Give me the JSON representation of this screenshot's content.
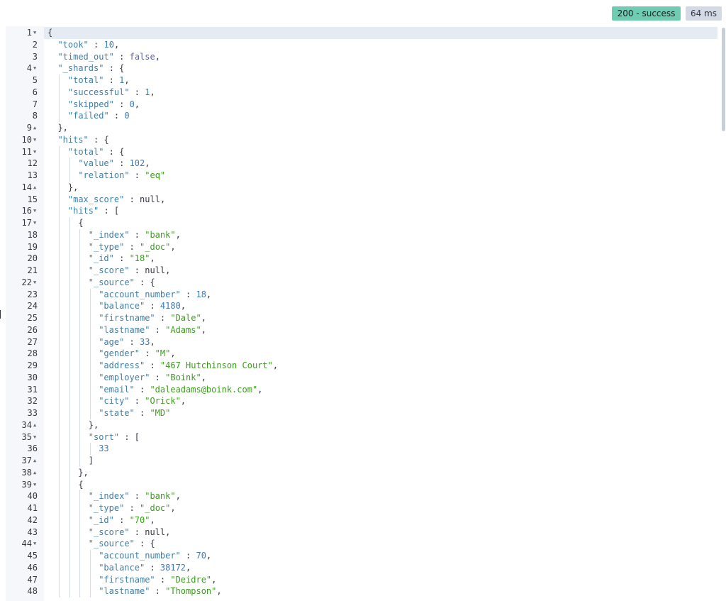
{
  "status": {
    "code_label": "200 - success",
    "time_label": "64 ms"
  },
  "colors": {
    "success": "#6dccb1",
    "time_badge": "#d3dae6",
    "key": "#3f7ea6",
    "string": "#3c9c1e",
    "number": "#3d7bb5",
    "boolean": "#5f60b7",
    "gutter": "#f5f7fa",
    "active_line": "#e5ebf3"
  },
  "icons": {
    "fold_open": "chevron-down-icon",
    "fold_close": "chevron-up-icon"
  },
  "editor": {
    "lines": [
      {
        "n": "1",
        "f": "open",
        "d": 0,
        "t": [
          [
            "p",
            "{"
          ]
        ]
      },
      {
        "n": "2",
        "d": 1,
        "t": [
          [
            "k",
            "\"took\""
          ],
          [
            "p",
            " : "
          ],
          [
            "n",
            "10"
          ],
          [
            "p",
            ","
          ]
        ]
      },
      {
        "n": "3",
        "d": 1,
        "t": [
          [
            "k",
            "\"timed_out\""
          ],
          [
            "p",
            " : "
          ],
          [
            "b",
            "false"
          ],
          [
            "p",
            ","
          ]
        ]
      },
      {
        "n": "4",
        "f": "open",
        "d": 1,
        "t": [
          [
            "k",
            "\"_shards\""
          ],
          [
            "p",
            " : {"
          ]
        ]
      },
      {
        "n": "5",
        "d": 2,
        "t": [
          [
            "k",
            "\"total\""
          ],
          [
            "p",
            " : "
          ],
          [
            "n",
            "1"
          ],
          [
            "p",
            ","
          ]
        ]
      },
      {
        "n": "6",
        "d": 2,
        "t": [
          [
            "k",
            "\"successful\""
          ],
          [
            "p",
            " : "
          ],
          [
            "n",
            "1"
          ],
          [
            "p",
            ","
          ]
        ]
      },
      {
        "n": "7",
        "d": 2,
        "t": [
          [
            "k",
            "\"skipped\""
          ],
          [
            "p",
            " : "
          ],
          [
            "n",
            "0"
          ],
          [
            "p",
            ","
          ]
        ]
      },
      {
        "n": "8",
        "d": 2,
        "t": [
          [
            "k",
            "\"failed\""
          ],
          [
            "p",
            " : "
          ],
          [
            "n",
            "0"
          ]
        ]
      },
      {
        "n": "9",
        "f": "close",
        "d": 1,
        "t": [
          [
            "p",
            "},"
          ]
        ]
      },
      {
        "n": "10",
        "f": "open",
        "d": 1,
        "t": [
          [
            "k",
            "\"hits\""
          ],
          [
            "p",
            " : {"
          ]
        ]
      },
      {
        "n": "11",
        "f": "open",
        "d": 2,
        "t": [
          [
            "k",
            "\"total\""
          ],
          [
            "p",
            " : {"
          ]
        ]
      },
      {
        "n": "12",
        "d": 3,
        "t": [
          [
            "k",
            "\"value\""
          ],
          [
            "p",
            " : "
          ],
          [
            "n",
            "102"
          ],
          [
            "p",
            ","
          ]
        ]
      },
      {
        "n": "13",
        "d": 3,
        "t": [
          [
            "k",
            "\"relation\""
          ],
          [
            "p",
            " : "
          ],
          [
            "s",
            "\"eq\""
          ]
        ]
      },
      {
        "n": "14",
        "f": "close",
        "d": 2,
        "t": [
          [
            "p",
            "},"
          ]
        ]
      },
      {
        "n": "15",
        "d": 2,
        "t": [
          [
            "k",
            "\"max_score\""
          ],
          [
            "p",
            " : "
          ],
          [
            "nl",
            "null"
          ],
          [
            "p",
            ","
          ]
        ]
      },
      {
        "n": "16",
        "f": "open",
        "d": 2,
        "t": [
          [
            "k",
            "\"hits\""
          ],
          [
            "p",
            " : ["
          ]
        ]
      },
      {
        "n": "17",
        "f": "open",
        "d": 3,
        "t": [
          [
            "p",
            "{"
          ]
        ]
      },
      {
        "n": "18",
        "d": 4,
        "t": [
          [
            "k",
            "\"_index\""
          ],
          [
            "p",
            " : "
          ],
          [
            "s",
            "\"bank\""
          ],
          [
            "p",
            ","
          ]
        ]
      },
      {
        "n": "19",
        "d": 4,
        "t": [
          [
            "k",
            "\"_type\""
          ],
          [
            "p",
            " : "
          ],
          [
            "s",
            "\"_doc\""
          ],
          [
            "p",
            ","
          ]
        ]
      },
      {
        "n": "20",
        "d": 4,
        "t": [
          [
            "k",
            "\"_id\""
          ],
          [
            "p",
            " : "
          ],
          [
            "s",
            "\"18\""
          ],
          [
            "p",
            ","
          ]
        ]
      },
      {
        "n": "21",
        "d": 4,
        "t": [
          [
            "k",
            "\"_score\""
          ],
          [
            "p",
            " : "
          ],
          [
            "nl",
            "null"
          ],
          [
            "p",
            ","
          ]
        ]
      },
      {
        "n": "22",
        "f": "open",
        "d": 4,
        "t": [
          [
            "k",
            "\"_source\""
          ],
          [
            "p",
            " : {"
          ]
        ]
      },
      {
        "n": "23",
        "d": 5,
        "t": [
          [
            "k",
            "\"account_number\""
          ],
          [
            "p",
            " : "
          ],
          [
            "n",
            "18"
          ],
          [
            "p",
            ","
          ]
        ]
      },
      {
        "n": "24",
        "d": 5,
        "t": [
          [
            "k",
            "\"balance\""
          ],
          [
            "p",
            " : "
          ],
          [
            "n",
            "4180"
          ],
          [
            "p",
            ","
          ]
        ]
      },
      {
        "n": "25",
        "d": 5,
        "t": [
          [
            "k",
            "\"firstname\""
          ],
          [
            "p",
            " : "
          ],
          [
            "s",
            "\"Dale\""
          ],
          [
            "p",
            ","
          ]
        ]
      },
      {
        "n": "26",
        "d": 5,
        "t": [
          [
            "k",
            "\"lastname\""
          ],
          [
            "p",
            " : "
          ],
          [
            "s",
            "\"Adams\""
          ],
          [
            "p",
            ","
          ]
        ]
      },
      {
        "n": "27",
        "d": 5,
        "t": [
          [
            "k",
            "\"age\""
          ],
          [
            "p",
            " : "
          ],
          [
            "n",
            "33"
          ],
          [
            "p",
            ","
          ]
        ]
      },
      {
        "n": "28",
        "d": 5,
        "t": [
          [
            "k",
            "\"gender\""
          ],
          [
            "p",
            " : "
          ],
          [
            "s",
            "\"M\""
          ],
          [
            "p",
            ","
          ]
        ]
      },
      {
        "n": "29",
        "d": 5,
        "t": [
          [
            "k",
            "\"address\""
          ],
          [
            "p",
            " : "
          ],
          [
            "s",
            "\"467 Hutchinson Court\""
          ],
          [
            "p",
            ","
          ]
        ]
      },
      {
        "n": "30",
        "d": 5,
        "t": [
          [
            "k",
            "\"employer\""
          ],
          [
            "p",
            " : "
          ],
          [
            "s",
            "\"Boink\""
          ],
          [
            "p",
            ","
          ]
        ]
      },
      {
        "n": "31",
        "d": 5,
        "t": [
          [
            "k",
            "\"email\""
          ],
          [
            "p",
            " : "
          ],
          [
            "s",
            "\"daleadams@boink.com\""
          ],
          [
            "p",
            ","
          ]
        ]
      },
      {
        "n": "32",
        "d": 5,
        "t": [
          [
            "k",
            "\"city\""
          ],
          [
            "p",
            " : "
          ],
          [
            "s",
            "\"Orick\""
          ],
          [
            "p",
            ","
          ]
        ]
      },
      {
        "n": "33",
        "d": 5,
        "t": [
          [
            "k",
            "\"state\""
          ],
          [
            "p",
            " : "
          ],
          [
            "s",
            "\"MD\""
          ]
        ]
      },
      {
        "n": "34",
        "f": "close",
        "d": 4,
        "t": [
          [
            "p",
            "},"
          ]
        ]
      },
      {
        "n": "35",
        "f": "open",
        "d": 4,
        "t": [
          [
            "k",
            "\"sort\""
          ],
          [
            "p",
            " : ["
          ]
        ]
      },
      {
        "n": "36",
        "d": 5,
        "t": [
          [
            "n",
            "33"
          ]
        ]
      },
      {
        "n": "37",
        "f": "close",
        "d": 4,
        "t": [
          [
            "p",
            "]"
          ]
        ]
      },
      {
        "n": "38",
        "f": "close",
        "d": 3,
        "t": [
          [
            "p",
            "},"
          ]
        ]
      },
      {
        "n": "39",
        "f": "open",
        "d": 3,
        "t": [
          [
            "p",
            "{"
          ]
        ]
      },
      {
        "n": "40",
        "d": 4,
        "t": [
          [
            "k",
            "\"_index\""
          ],
          [
            "p",
            " : "
          ],
          [
            "s",
            "\"bank\""
          ],
          [
            "p",
            ","
          ]
        ]
      },
      {
        "n": "41",
        "d": 4,
        "t": [
          [
            "k",
            "\"_type\""
          ],
          [
            "p",
            " : "
          ],
          [
            "s",
            "\"_doc\""
          ],
          [
            "p",
            ","
          ]
        ]
      },
      {
        "n": "42",
        "d": 4,
        "t": [
          [
            "k",
            "\"_id\""
          ],
          [
            "p",
            " : "
          ],
          [
            "s",
            "\"70\""
          ],
          [
            "p",
            ","
          ]
        ]
      },
      {
        "n": "43",
        "d": 4,
        "t": [
          [
            "k",
            "\"_score\""
          ],
          [
            "p",
            " : "
          ],
          [
            "nl",
            "null"
          ],
          [
            "p",
            ","
          ]
        ]
      },
      {
        "n": "44",
        "f": "open",
        "d": 4,
        "t": [
          [
            "k",
            "\"_source\""
          ],
          [
            "p",
            " : {"
          ]
        ]
      },
      {
        "n": "45",
        "d": 5,
        "t": [
          [
            "k",
            "\"account_number\""
          ],
          [
            "p",
            " : "
          ],
          [
            "n",
            "70"
          ],
          [
            "p",
            ","
          ]
        ]
      },
      {
        "n": "46",
        "d": 5,
        "t": [
          [
            "k",
            "\"balance\""
          ],
          [
            "p",
            " : "
          ],
          [
            "n",
            "38172"
          ],
          [
            "p",
            ","
          ]
        ]
      },
      {
        "n": "47",
        "d": 5,
        "t": [
          [
            "k",
            "\"firstname\""
          ],
          [
            "p",
            " : "
          ],
          [
            "s",
            "\"Deidre\""
          ],
          [
            "p",
            ","
          ]
        ]
      },
      {
        "n": "48",
        "d": 5,
        "t": [
          [
            "k",
            "\"lastname\""
          ],
          [
            "p",
            " : "
          ],
          [
            "s",
            "\"Thompson\""
          ],
          [
            "p",
            ","
          ]
        ]
      }
    ]
  }
}
